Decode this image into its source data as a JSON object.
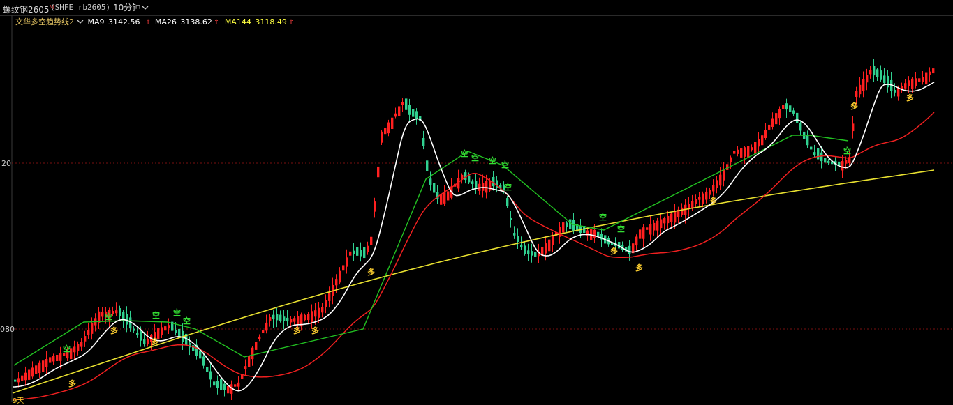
{
  "header": {
    "symbol_name": "螺纹钢2605",
    "symbol_flag": "M",
    "symbol_code": "(SHFE rb2605)",
    "period": "10分钟",
    "period_icon": "chevron-down-icon"
  },
  "legend": {
    "indicator_name": "文华多空趋势线2",
    "ma9_label": "MA9",
    "ma9_value": "3142.56",
    "ma26_label": "MA26",
    "ma26_value": "3138.62",
    "ma144_label": "MA144",
    "ma144_value": "3118.49",
    "up_arrow": "↑"
  },
  "axis_labels": {
    "upper": "20",
    "lower": "080"
  },
  "bottom_label": "9天",
  "signals": {
    "bear": "空",
    "bull": "多"
  },
  "colors": {
    "up": "#ff2020",
    "down": "#30d090",
    "ma_fast": "#ffffff",
    "ma_mid": "#ff2020",
    "ma_slow": "#ffff40",
    "trend": "#20c020",
    "grid": "#8b0000"
  }
}
